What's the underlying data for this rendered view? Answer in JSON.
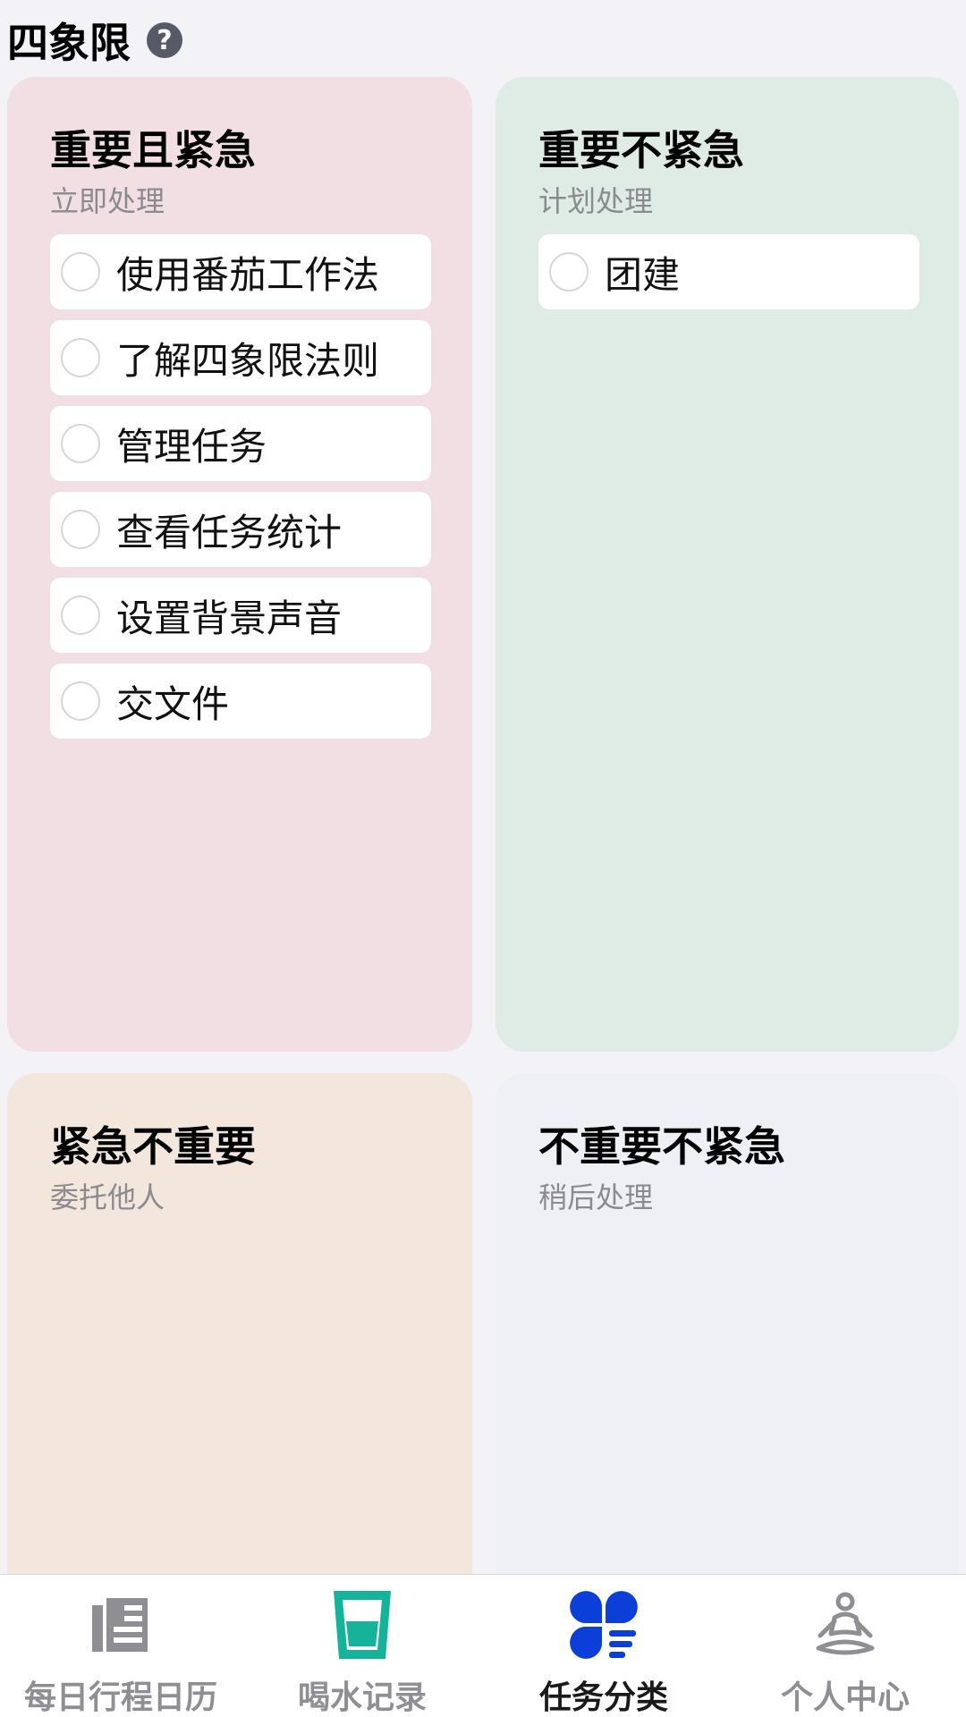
{
  "header": {
    "title": "四象限",
    "help_icon": "question-circle-icon",
    "help_glyph": "?"
  },
  "quadrants": [
    {
      "title": "重要且紧急",
      "subtitle": "立即处理",
      "color": "#f1dfe3",
      "tasks": [
        "使用番茄工作法",
        "了解四象限法则",
        "管理任务",
        "查看任务统计",
        "设置背景声音",
        "交文件"
      ]
    },
    {
      "title": "重要不紧急",
      "subtitle": "计划处理",
      "color": "#deece5",
      "tasks": [
        "团建"
      ]
    },
    {
      "title": "紧急不重要",
      "subtitle": "委托他人",
      "color": "#f2e6dd",
      "tasks": []
    },
    {
      "title": "不重要不紧急",
      "subtitle": "稍后处理",
      "color": "#eff0f5",
      "tasks": []
    }
  ],
  "tabbar": {
    "active_color": "#0b3fd8",
    "water_color": "#14b39a",
    "inactive_color": "#8e8e93",
    "tabs": [
      {
        "label": "每日行程日历",
        "icon": "newspaper-icon",
        "active": false
      },
      {
        "label": "喝水记录",
        "icon": "water-cup-icon",
        "active": false
      },
      {
        "label": "任务分类",
        "icon": "quadrant-category-icon",
        "active": true
      },
      {
        "label": "个人中心",
        "icon": "meditation-person-icon",
        "active": false
      }
    ]
  }
}
